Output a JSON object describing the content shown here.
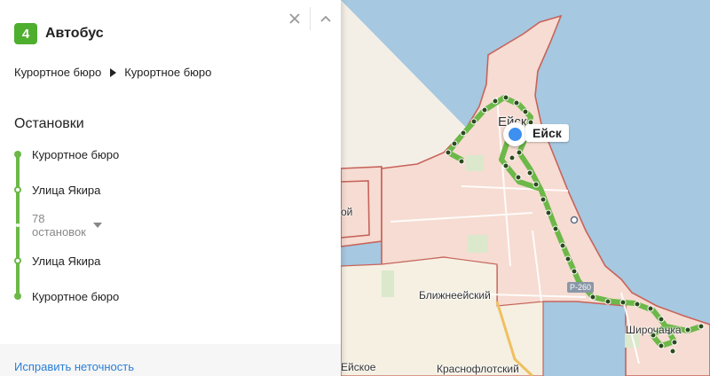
{
  "panel": {
    "route_number": "4",
    "transport_type": "Автобус",
    "route_from": "Курортное бюро",
    "route_to": "Курортное бюро",
    "stops_title": "Остановки",
    "stops": [
      {
        "name": "Курортное бюро",
        "marker": "filled"
      },
      {
        "name": "Улица Якира",
        "marker": "hollow"
      },
      {
        "collapsed": "78 остановок"
      },
      {
        "name": "Улица Якира",
        "marker": "hollow"
      },
      {
        "name": "Курортное бюро",
        "marker": "filled"
      }
    ],
    "footer_link": "Исправить неточность",
    "icons": {
      "close": "close-icon",
      "collapse": "chevron-up-icon",
      "direction": "triangle-right-icon",
      "expand": "triangle-down-icon"
    }
  },
  "map": {
    "city_name": "Ейск",
    "city_label_partial": "Ейск",
    "place_labels": {
      "blizhneeysky": "Ближнеейский",
      "shirochanka": "Широчанка",
      "krasnoflotsky": "Краснофлотский",
      "eyskoe": "Ейское",
      "left_partial": "ой"
    },
    "road_number": "Р-260",
    "colors": {
      "route": "#6cb848",
      "route_stop": "#2c4a1e",
      "sea": "#a6c8e0",
      "land": "#f4efe6",
      "city_area": "#f6dcd2",
      "border": "#c7635a",
      "city_pin": "#3d8ff0",
      "route_badge": "#4eae2e",
      "link": "#2b7fd6"
    }
  }
}
